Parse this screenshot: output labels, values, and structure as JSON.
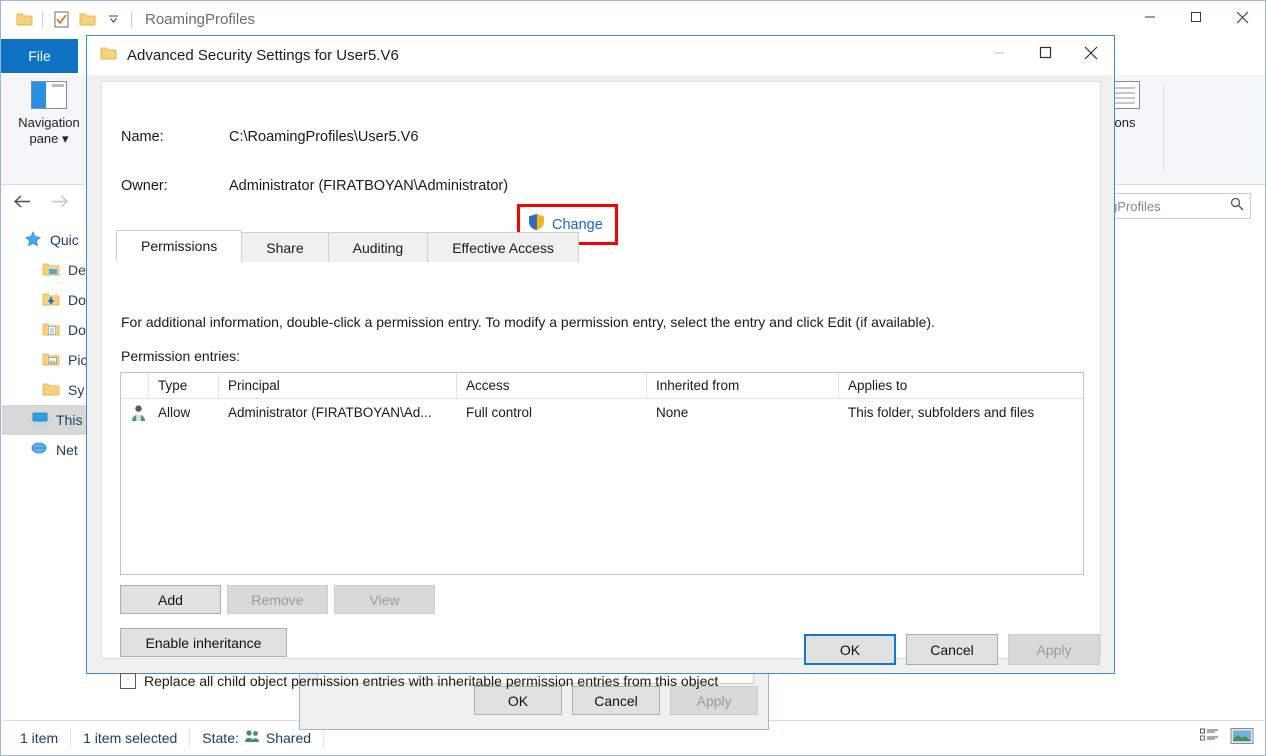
{
  "explorer": {
    "title": "RoamingProfiles",
    "quick_access_icons": [
      "folder-icon",
      "properties-icon",
      "folder-icon",
      "chevron-down-icon"
    ],
    "window_controls": [
      "minimize",
      "maximize",
      "close"
    ],
    "file_tab": "File",
    "help_label": "?",
    "ribbon": {
      "navigation_pane_label_line1": "Navigation",
      "navigation_pane_label_line2": "pane",
      "options_label": "ons"
    },
    "search": {
      "value": "gProfiles",
      "placeholder": "Search RoamingProfiles"
    },
    "sidebar": [
      {
        "label": "Quic",
        "icon": "star-icon",
        "indent": false,
        "selected": false
      },
      {
        "label": "De",
        "icon": "desktop-folder-icon",
        "indent": true,
        "selected": false
      },
      {
        "label": "Do",
        "icon": "downloads-folder-icon",
        "indent": true,
        "selected": false
      },
      {
        "label": "Do",
        "icon": "documents-folder-icon",
        "indent": true,
        "selected": false
      },
      {
        "label": "Pic",
        "icon": "pictures-folder-icon",
        "indent": true,
        "selected": false
      },
      {
        "label": "Sy",
        "icon": "folder-icon",
        "indent": true,
        "selected": false
      },
      {
        "label": "This",
        "icon": "this-pc-icon",
        "indent": false,
        "selected": true
      },
      {
        "label": "Net",
        "icon": "network-icon",
        "indent": false,
        "selected": false
      }
    ],
    "status": {
      "item_count": "1 item",
      "selection": "1 item selected",
      "state_label": "State:",
      "state_value": "Shared"
    },
    "view_buttons": [
      "details-view-icon",
      "large-icons-view-icon"
    ]
  },
  "properties_dialog": {
    "buttons": [
      {
        "label": "OK",
        "disabled": false,
        "default": false
      },
      {
        "label": "Cancel",
        "disabled": false,
        "default": false
      },
      {
        "label": "Apply",
        "disabled": true,
        "default": false
      }
    ]
  },
  "advanced_dialog": {
    "title": "Advanced Security Settings for User5.V6",
    "title_icon": "folder-icon",
    "window_controls": [
      "minimize",
      "maximize",
      "close"
    ],
    "name_label": "Name:",
    "name_value": "C:\\RoamingProfiles\\User5.V6",
    "owner_label": "Owner:",
    "owner_value": "Administrator (FIRATBOYAN\\Administrator)",
    "change_link": "Change",
    "change_icon": "uac-shield-icon",
    "highlight_color": "#fb0000",
    "link_color": "#1468c4",
    "tabs": [
      {
        "label": "Permissions",
        "active": true
      },
      {
        "label": "Share",
        "active": false
      },
      {
        "label": "Auditing",
        "active": false
      },
      {
        "label": "Effective Access",
        "active": false
      }
    ],
    "description": "For additional information, double-click a permission entry. To modify a permission entry, select the entry and click Edit (if available).",
    "entries_label": "Permission entries:",
    "table": {
      "columns": [
        "",
        "Type",
        "Principal",
        "Access",
        "Inherited from",
        "Applies to"
      ],
      "rows": [
        {
          "icon": "user-icon",
          "type": "Allow",
          "principal": "Administrator (FIRATBOYAN\\Ad...",
          "access": "Full control",
          "inherited_from": "None",
          "applies_to": "This folder, subfolders and files"
        }
      ]
    },
    "action_buttons": [
      {
        "label": "Add",
        "disabled": false
      },
      {
        "label": "Remove",
        "disabled": true
      },
      {
        "label": "View",
        "disabled": true
      }
    ],
    "inheritance_button": {
      "label": "Enable inheritance",
      "disabled": false
    },
    "replace_checkbox": {
      "label": "Replace all child object permission entries with inheritable permission entries from this object",
      "checked": false
    },
    "footer_buttons": [
      {
        "label": "OK",
        "disabled": false,
        "default": true
      },
      {
        "label": "Cancel",
        "disabled": false,
        "default": false
      },
      {
        "label": "Apply",
        "disabled": true,
        "default": false
      }
    ]
  }
}
